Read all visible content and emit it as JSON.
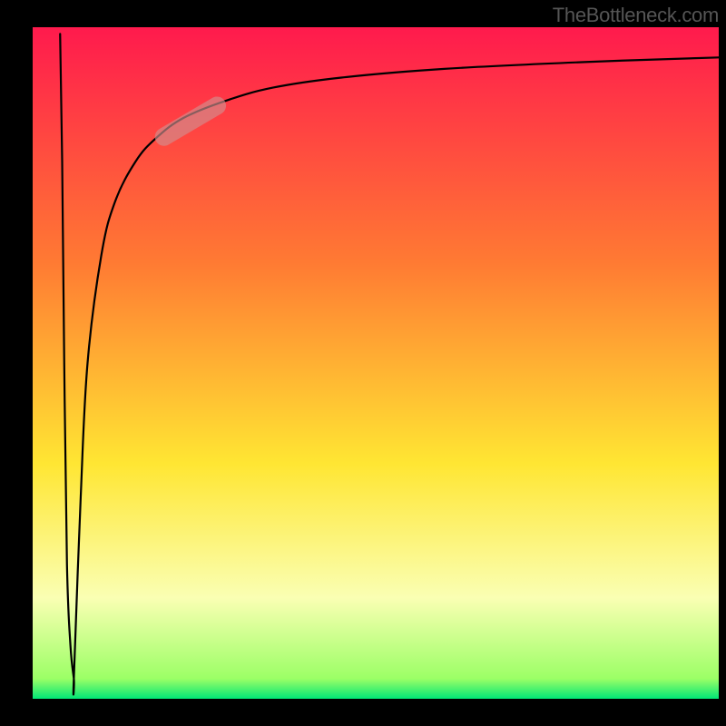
{
  "watermark": "TheBottleneck.com",
  "chart_data": {
    "type": "line",
    "title": "",
    "xlabel": "",
    "ylabel": "",
    "xlim": [
      0,
      100
    ],
    "ylim": [
      0,
      100
    ],
    "background_gradient": {
      "stops": [
        {
          "offset": 0.0,
          "color": "#ff1a4d"
        },
        {
          "offset": 0.35,
          "color": "#ff7a33"
        },
        {
          "offset": 0.65,
          "color": "#ffe633"
        },
        {
          "offset": 0.85,
          "color": "#faffb3"
        },
        {
          "offset": 0.97,
          "color": "#9cff66"
        },
        {
          "offset": 1.0,
          "color": "#00e676"
        }
      ]
    },
    "series": [
      {
        "name": "curve-down",
        "x": [
          4,
          4.3,
          4.6,
          5.0,
          5.5,
          6.0
        ],
        "y": [
          99,
          80,
          50,
          20,
          8,
          3
        ]
      },
      {
        "name": "curve-up",
        "x": [
          6.0,
          7,
          8,
          10,
          12,
          15,
          18,
          22,
          28,
          35,
          45,
          60,
          80,
          100
        ],
        "y": [
          3,
          30,
          50,
          66,
          74,
          80,
          83.5,
          86.5,
          89,
          91,
          92.5,
          93.8,
          94.8,
          95.5
        ]
      }
    ],
    "highlight_segment": {
      "x_range": [
        18,
        28
      ],
      "y_range": [
        83,
        89
      ],
      "color": "#d18f8f",
      "opacity": 0.65
    },
    "axes": {
      "show_ticks": false,
      "show_grid": false,
      "border_color": "#000000"
    }
  }
}
